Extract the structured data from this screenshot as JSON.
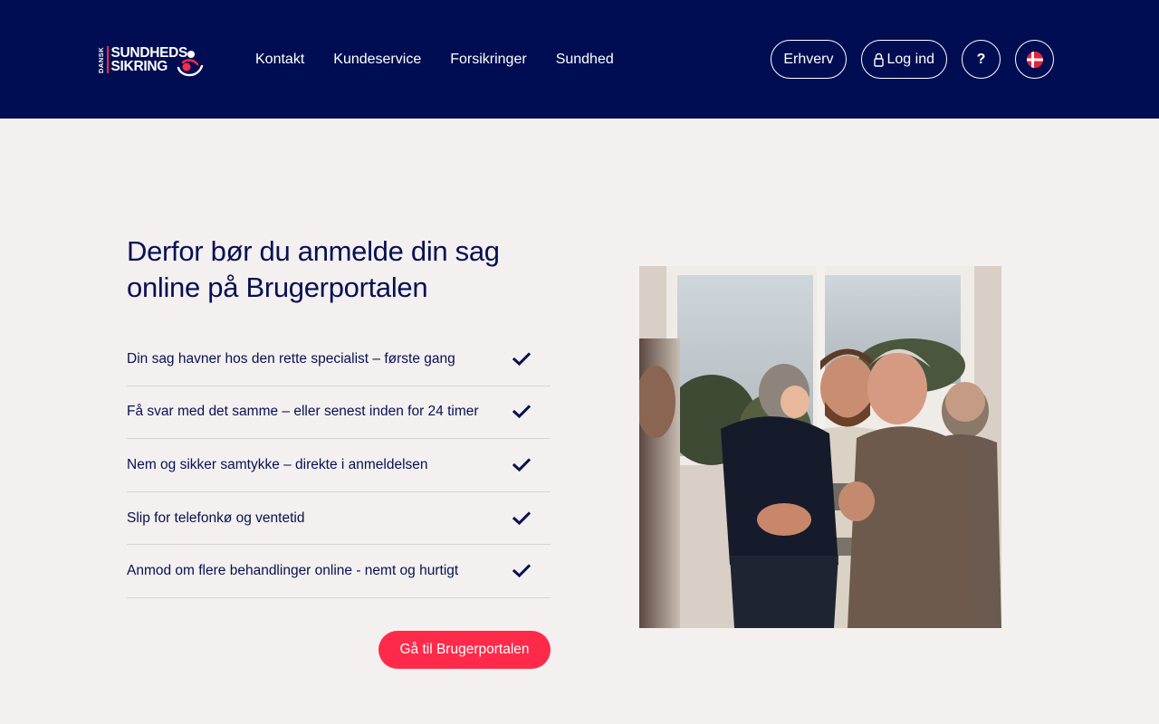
{
  "header": {
    "logo": {
      "small": "DANSK",
      "line1": "SUNDHEDS",
      "line2": "SIKRING"
    },
    "nav": [
      "Kontakt",
      "Kundeservice",
      "Forsikringer",
      "Sundhed"
    ],
    "buttons": {
      "erhverv": "Erhverv",
      "login": "Log ind",
      "help": "?"
    },
    "language_icon": "danish-flag-icon"
  },
  "main": {
    "title": "Derfor bør du anmelde din sag online på Brugerportalen",
    "benefits": [
      "Din sag havner hos den rette specialist – første gang",
      "Få svar med det samme – eller senest inden for 24 timer",
      "Nem og sikker samtykke – direkte i anmeldelsen",
      "Slip for telefonkø og ventetid",
      "Anmod om flere behandlinger online - nemt og hurtigt"
    ],
    "benefit_icon": "check-icon",
    "cta": "Gå til Brugerportalen"
  },
  "colors": {
    "header_bg": "#000d53",
    "page_bg": "#f4f0ef",
    "text": "#061153",
    "accent": "#ff2a4a",
    "divider": "#d9d3d2"
  }
}
